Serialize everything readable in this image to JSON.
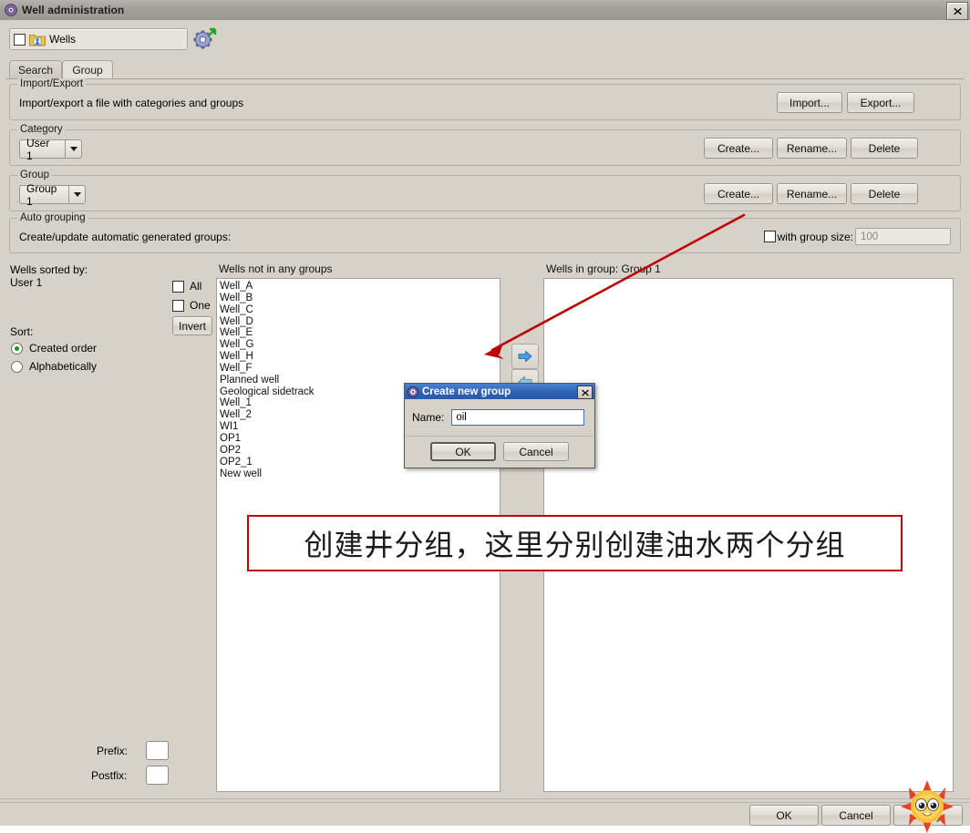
{
  "window": {
    "title": "Well administration",
    "icon": "app-icon",
    "close_label": "✕"
  },
  "topbar": {
    "combo_label": "Wells",
    "checkbox_checked": false,
    "gear_icon": "gear-icon"
  },
  "tabs": [
    {
      "label": "Search",
      "active": false
    },
    {
      "label": "Group",
      "active": true
    }
  ],
  "import_export": {
    "legend": "Import/Export",
    "description": "Import/export a file with categories and groups",
    "import_button": "Import...",
    "export_button": "Export..."
  },
  "category": {
    "legend": "Category",
    "selected": "User 1",
    "create_button": "Create...",
    "rename_button": "Rename...",
    "delete_button": "Delete"
  },
  "group": {
    "legend": "Group",
    "selected": "Group 1",
    "create_button": "Create...",
    "rename_button": "Rename...",
    "delete_button": "Delete"
  },
  "auto_grouping": {
    "legend": "Auto grouping",
    "description": "Create/update automatic generated groups:",
    "with_group_size_label": "with group size:",
    "with_group_size_checked": false,
    "group_size_value": "100"
  },
  "left_panel": {
    "sorted_by_label": "Wells sorted by:",
    "sorted_by_value": "User 1",
    "all_label": "All",
    "all_checked": false,
    "one_label": "One",
    "one_checked": false,
    "invert_button": "Invert",
    "sort_label": "Sort:",
    "sort_options": [
      {
        "label": "Created order",
        "selected": true
      },
      {
        "label": "Alphabetically",
        "selected": false
      }
    ],
    "prefix_label": "Prefix:",
    "prefix_value": "",
    "postfix_label": "Postfix:",
    "postfix_value": ""
  },
  "wells_not_grouped": {
    "caption": "Wells not in any groups",
    "items": [
      "Well_A",
      "Well_B",
      "Well_C",
      "Well_D",
      "Well_E",
      "Well_G",
      "Well_H",
      "Well_F",
      "Planned well",
      "Geological sidetrack",
      "Well_1",
      "Well_2",
      "WI1",
      "OP1",
      "OP2",
      "OP2_1",
      "New well"
    ]
  },
  "wells_in_group": {
    "caption": "Wells in group: Group 1",
    "items": []
  },
  "transfer": {
    "add_icon": "arrow-right-icon",
    "remove_icon": "arrow-left-icon"
  },
  "footer": {
    "ok_button": "OK",
    "cancel_button": "Cancel",
    "apply_button": "Apply"
  },
  "dialog": {
    "title": "Create new group",
    "icon": "dialog-app-icon",
    "close_label": "✕",
    "name_label": "Name:",
    "name_value": "oil",
    "ok_button": "OK",
    "cancel_button": "Cancel"
  },
  "annotation": {
    "text": "创建井分组，这里分别创建油水两个分组",
    "box_color": "#c00000",
    "arrow_color": "#c00000"
  },
  "colors": {
    "window_bg": "#d6d2ca",
    "titlebar": "#a3a09b",
    "dialog_title": "#2f63b5",
    "list_bg": "#ffffff",
    "radio_on": "#0a9e19"
  }
}
